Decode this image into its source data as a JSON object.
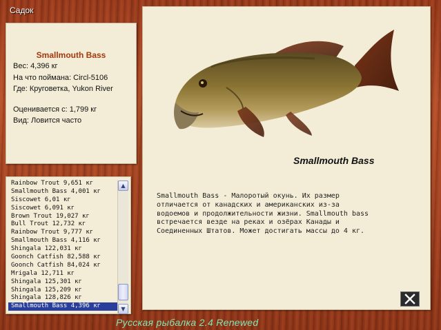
{
  "window": {
    "title": "Садок"
  },
  "info": {
    "fish_name": "Smallmouth Bass",
    "weight": "Вес: 4,396 кг",
    "bait": "На что поймана: Circl-5106",
    "location": "Где: Круговетка, Yukon River",
    "value": "Оценивается с: 1,799 кг",
    "status": "Вид: Ловится часто"
  },
  "catch_list": {
    "items": [
      "Rainbow Trout 9,651 кг",
      "Smallmouth Bass 4,001 кг",
      "Siscowet 6,01 кг",
      "Siscowet 6,091 кг",
      "Brown Trout 19,027 кг",
      "Bull Trout 12,732 кг",
      "Rainbow Trout 9,777 кг",
      "Smallmouth Bass 4,116 кг",
      "Shingala 122,031 кг",
      "Goonch Catfish 82,588 кг",
      "Goonch Catfish 84,024 кг",
      "Mrigala 12,711 кг",
      "Shingala 125,301 кг",
      "Shingala 125,209 кг",
      "Shingala 128,826 кг",
      "Smallmouth Bass 4,396 кг"
    ],
    "selected_index": 15,
    "scroll_up_icon": "triangle-up",
    "scroll_down_icon": "triangle-down"
  },
  "detail": {
    "fish_name": "Smallmouth  Bass",
    "description": "Smallmouth Bass - Малоротый окунь. Их размер отличается от канадских и американских из-за водоемов и продолжительности жизни. Smallmouth bass встречается везде на реках и озёрах  Канады и Соединенных Штатов. Может достигать массы до 4 кг."
  },
  "close_icon": "close-x",
  "footer": "Русская рыбалка 2.4 Renewed",
  "colors": {
    "wood": "#a54322",
    "panel": "#f3ecd6",
    "fish_name_accent": "#a4380f",
    "selection": "#2a3f9c",
    "footer": "#7fe6b5"
  }
}
